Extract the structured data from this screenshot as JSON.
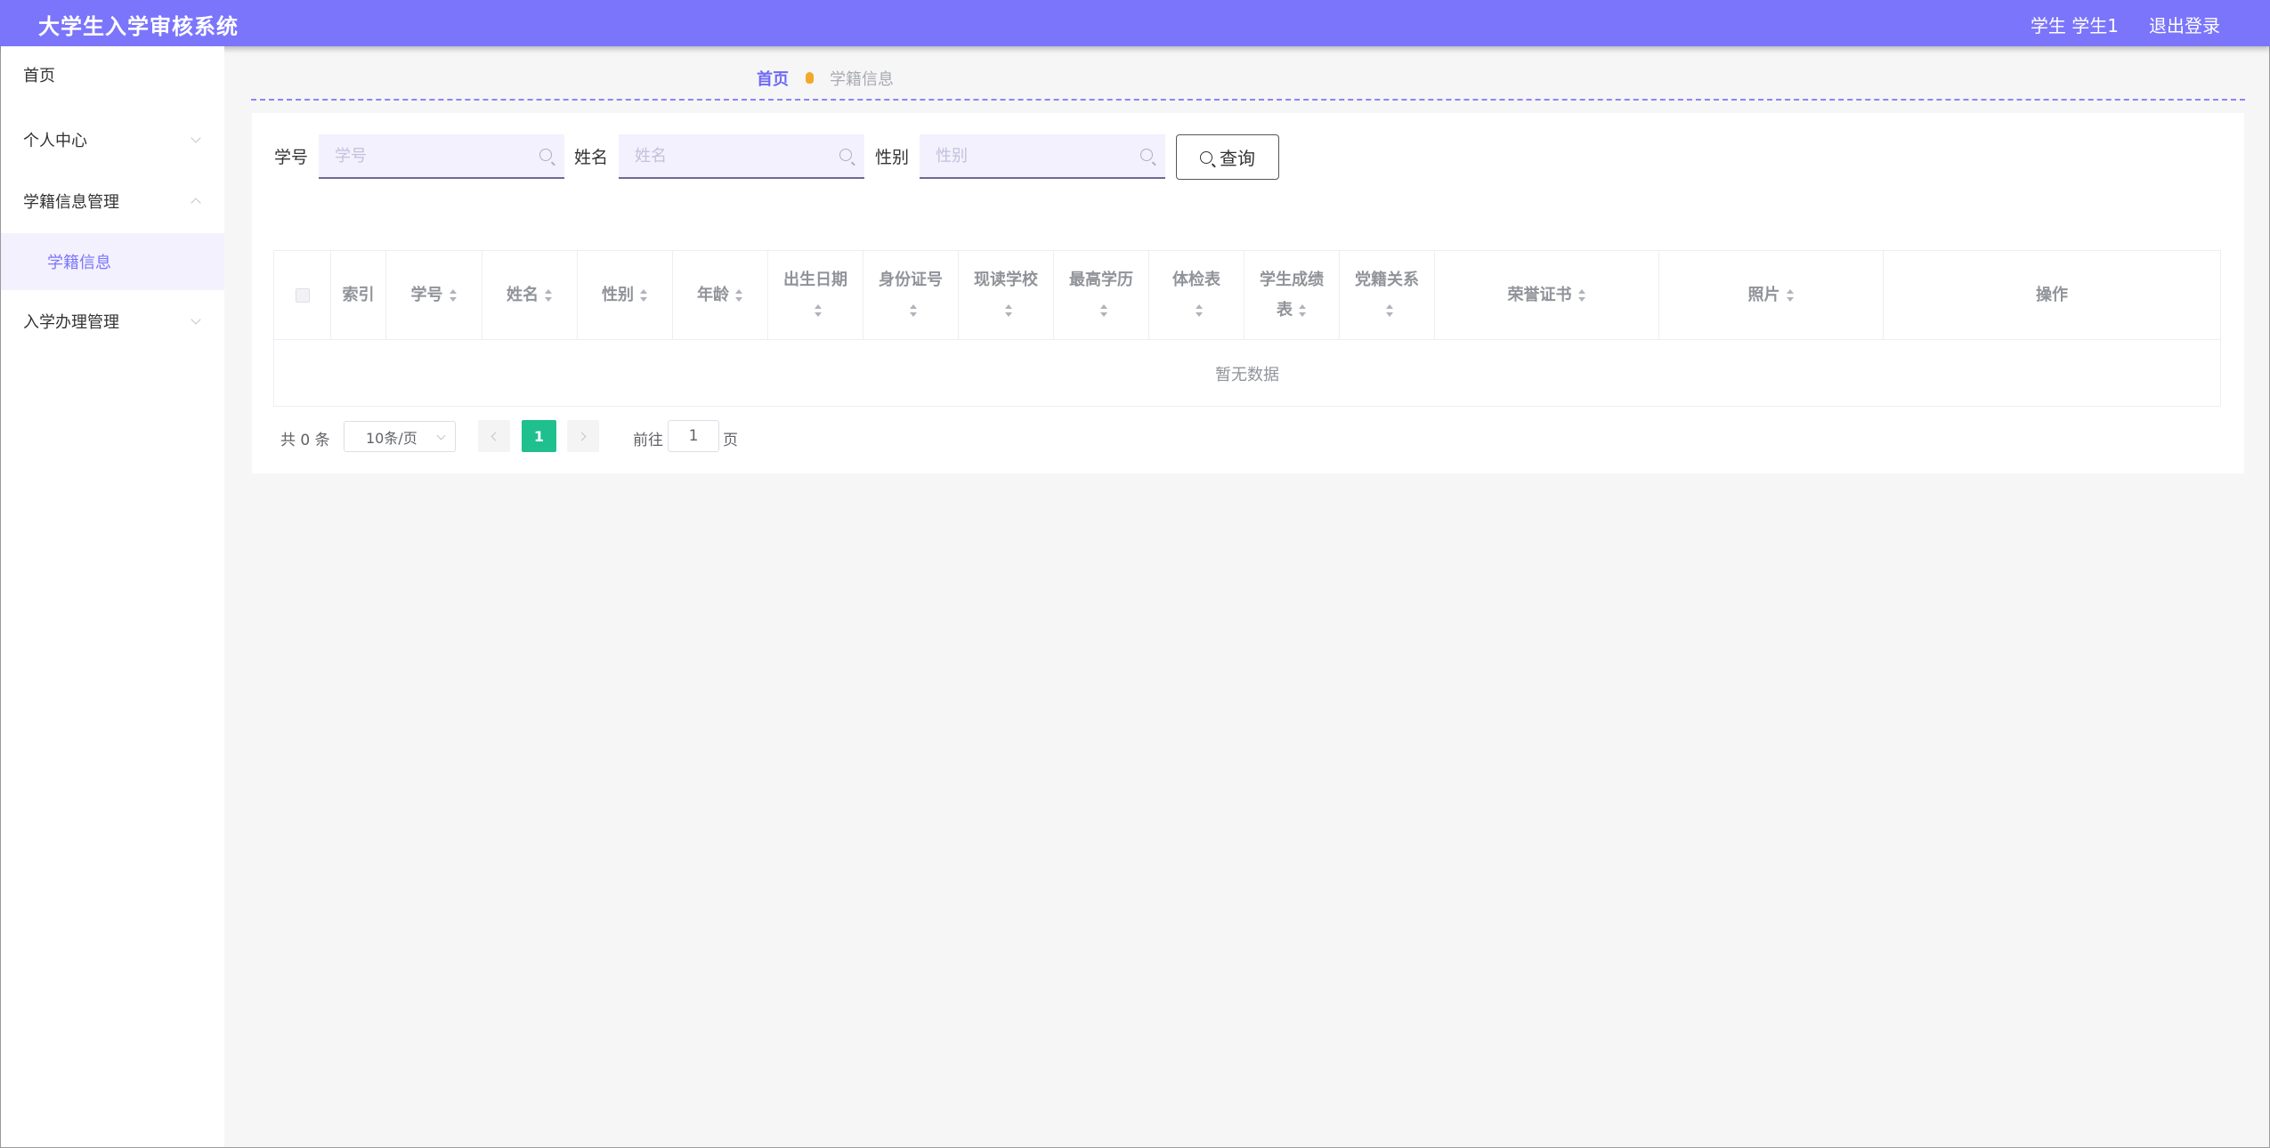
{
  "app": {
    "title": "大学生入学审核系统",
    "user": "学生 学生1",
    "logout": "退出登录"
  },
  "sidebar": {
    "items": [
      {
        "label": "首页"
      },
      {
        "label": "个人中心"
      },
      {
        "label": "学籍信息管理"
      },
      {
        "label": "学籍信息"
      },
      {
        "label": "入学办理管理"
      }
    ]
  },
  "breadcrumb": {
    "home": "首页",
    "current": "学籍信息"
  },
  "search": {
    "fields": [
      {
        "label": "学号",
        "placeholder": "学号",
        "value": ""
      },
      {
        "label": "姓名",
        "placeholder": "姓名",
        "value": ""
      },
      {
        "label": "性别",
        "placeholder": "性别",
        "value": ""
      }
    ],
    "query_label": "查询"
  },
  "table": {
    "columns": [
      "索引",
      "学号",
      "姓名",
      "性别",
      "年龄",
      "出生日期",
      "身份证号",
      "现读学校",
      "最高学历",
      "体检表",
      "学生成绩表",
      "党籍关系",
      "荣誉证书",
      "照片",
      "操作"
    ],
    "column_sortable": [
      false,
      true,
      true,
      true,
      true,
      true,
      true,
      true,
      true,
      true,
      true,
      true,
      true,
      true,
      false
    ],
    "empty_text": "暂无数据",
    "rows": []
  },
  "pagination": {
    "total_text": "共 0 条",
    "page_size": "10条/页",
    "current_page": "1",
    "goto_prefix": "前往",
    "goto_value": "1",
    "goto_suffix": "页"
  },
  "colors": {
    "brand": "#7b75fb",
    "active_page": "#1fc08e",
    "sidebar_active_bg": "#f3f1fd"
  }
}
